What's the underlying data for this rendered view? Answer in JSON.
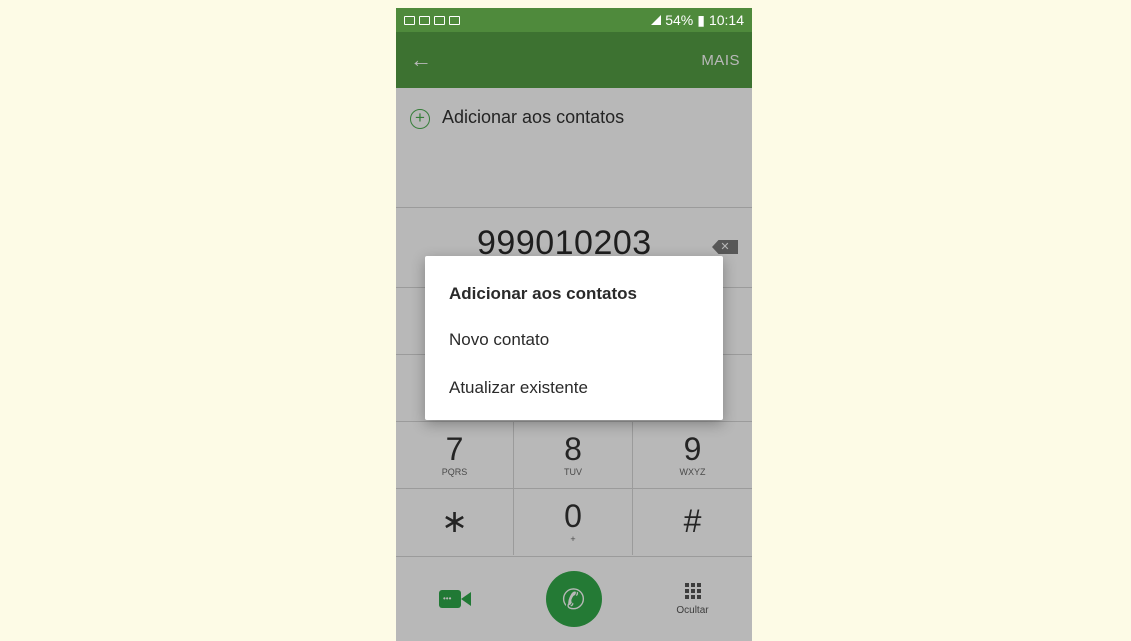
{
  "statusbar": {
    "battery": "54%",
    "time": "10:14"
  },
  "appbar": {
    "back_icon": "arrow-left-icon",
    "more_label": "MAIS"
  },
  "add_contacts": {
    "icon": "plus-circle-icon",
    "label": "Adicionar aos contatos"
  },
  "dialer": {
    "number": "999010203",
    "keys": [
      [
        {
          "digit": "7",
          "letters": "PQRS"
        },
        {
          "digit": "8",
          "letters": "TUV"
        },
        {
          "digit": "9",
          "letters": "WXYZ"
        }
      ],
      [
        {
          "digit": "∗",
          "letters": ""
        },
        {
          "digit": "0",
          "letters": "+"
        },
        {
          "digit": "#",
          "letters": ""
        }
      ]
    ],
    "hide_label": "Ocultar"
  },
  "dialog": {
    "title": "Adicionar aos contatos",
    "options": [
      "Novo contato",
      "Atualizar existente"
    ]
  },
  "colors": {
    "status_bar": "#4f8a3c",
    "app_bar": "#559f44",
    "accent_green": "#32a94a",
    "page_background": "#fdfbe6"
  }
}
